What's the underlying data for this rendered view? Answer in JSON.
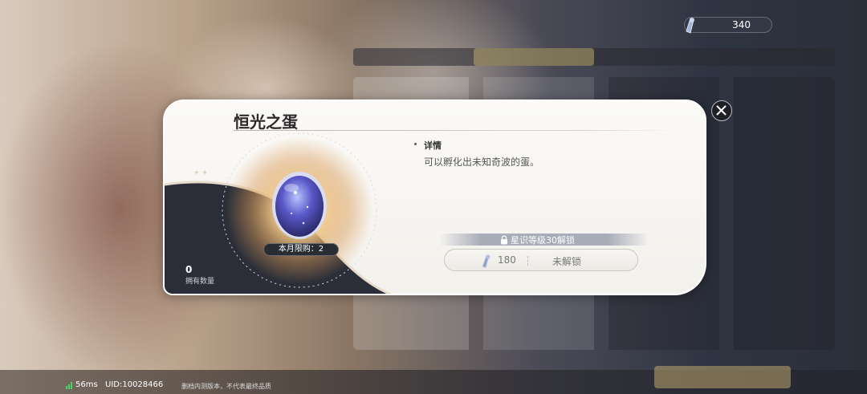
{
  "currency": {
    "icon": "crystal-icon",
    "amount": "340"
  },
  "item": {
    "title": "恒光之蛋",
    "detail_label": "详情",
    "description": "可以孵化出未知奇波的蛋。",
    "monthly_limit": "本月限购：2",
    "owned_count": "0",
    "owned_label": "拥有数量"
  },
  "purchase": {
    "lock_message": "星识等级30解锁",
    "price": "180",
    "status": "未解锁"
  },
  "footer": {
    "ping": "56ms",
    "uid": "UID:10028466",
    "notice": "删档内测版本，不代表最终品质"
  },
  "colors": {
    "panel": "#f6f5f2",
    "dark_swoosh": "#2b2e38",
    "glow": "#e9b072",
    "signal": "#49d36b"
  }
}
